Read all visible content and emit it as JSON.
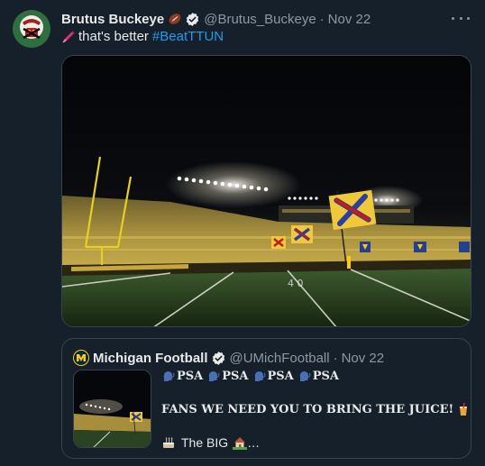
{
  "tweet": {
    "display_name": "Brutus Buckeye",
    "handle": "@Brutus_Buckeye",
    "separator": "·",
    "date": "Nov 22",
    "text": "that's better",
    "hashtag": "#BeatTTUN",
    "name_badge_icon": "football-icon",
    "verified_icon": "verified-badge-icon",
    "text_icon": "marker-icon",
    "more_icon": "more-options-icon",
    "image_desc": "stadium-night-image"
  },
  "quote": {
    "display_name": "Michigan Football",
    "handle": "@UMichFootball",
    "separator": "·",
    "date": "Nov 22",
    "psa_label": "PSA",
    "psa_icon": "speaking-head-icon",
    "line2": "FANS WE NEED YOU TO BRING THE JUICE!",
    "line2_icon": "juice-cup-icon",
    "line3_text": "The BIG",
    "line3_icons": [
      "birthday-cake-icon",
      "house-icon"
    ],
    "line3_ellipsis": "…"
  },
  "colors": {
    "background": "#15202b",
    "text": "#e7e9ea",
    "muted": "#8b98a5",
    "link": "#1d9bf0",
    "border": "#38444d",
    "maize": "#ffcb05",
    "blue": "#00274c"
  }
}
